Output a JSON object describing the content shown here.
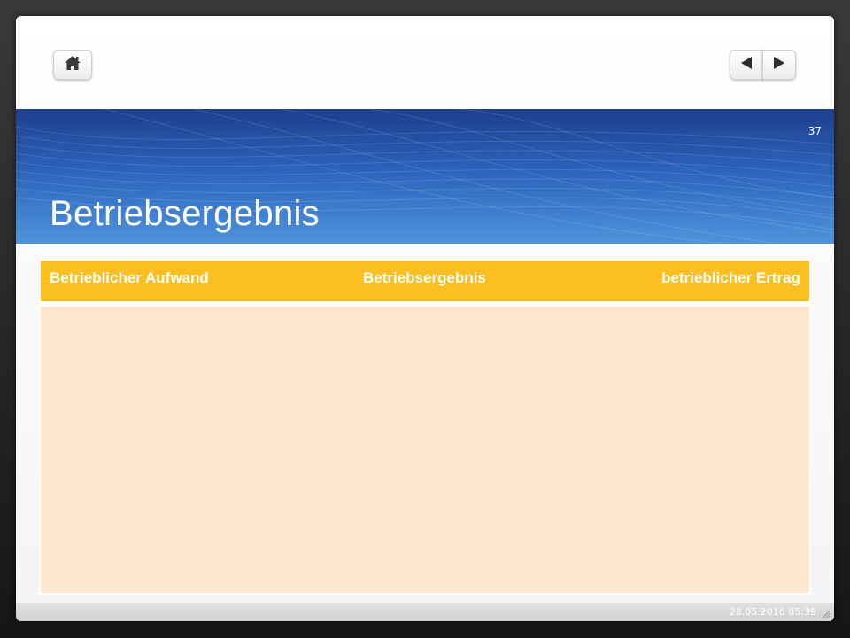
{
  "nav": {
    "home_icon": "home-icon",
    "prev_icon": "triangle-left-icon",
    "next_icon": "triangle-right-icon"
  },
  "slide": {
    "number": "37",
    "title": "Betriebsergebnis"
  },
  "table": {
    "headers": [
      "Betrieblicher Aufwand",
      "Betriebsergebnis",
      "betrieblicher Ertrag"
    ],
    "rows": []
  },
  "footer": {
    "date": "28.05.2016 05:39"
  },
  "colors": {
    "header": "#fbc020",
    "body": "#fde8cf",
    "band_top": "#1e3f8f",
    "band_bottom": "#4e93dc"
  }
}
